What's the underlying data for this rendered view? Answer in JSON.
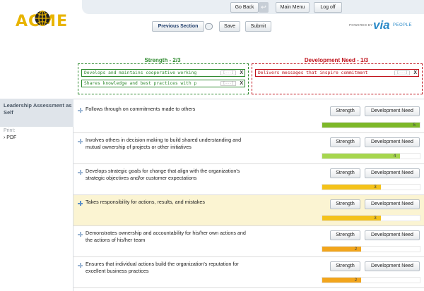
{
  "header": {
    "logo_text": "ACME",
    "nav": {
      "go_back": "Go Back",
      "main_menu": "Main Menu",
      "log_off": "Log off"
    },
    "powered_by": "POWERED BY",
    "brand_via": "via",
    "brand_people": "PEOPLE"
  },
  "actions": {
    "previous_section": "Previous Section",
    "save": "Save",
    "submit": "Submit"
  },
  "summary": {
    "strength": {
      "title": "Strength - 2/3",
      "color": "#2f8a2f",
      "items": [
        "Develops and maintains cooperative working",
        "Shares knowledge and best practices with p"
      ]
    },
    "development": {
      "title": "Development Need - 1/3",
      "color": "#c0121b",
      "items": [
        "Delivers messages that inspire commitment"
      ]
    },
    "chip_ellipsis": "[...]",
    "chip_remove": "X"
  },
  "sidebar": {
    "heading": "Leadership Assessment as Self",
    "print_label": "Print:",
    "pdf_link": "PDF"
  },
  "rows": [
    {
      "text": "Follows through on commitments made to others",
      "strength": "Strength",
      "development": "Development Need",
      "score": 5,
      "max": 5,
      "color": "#7db828"
    },
    {
      "text": "Involves others in decision making to build shared understanding and mutual ownership of projects or other initiatives",
      "strength": "Strength",
      "development": "Development Need",
      "score": 4,
      "max": 5,
      "color": "#a6d64e"
    },
    {
      "text": "Develops strategic goals for change that align with the organization's strategic objectives and/or customer expectations",
      "strength": "Strength",
      "development": "Development Need",
      "score": 3,
      "max": 5,
      "color": "#f4c21a"
    },
    {
      "text": "Takes responsibility for actions, results, and mistakes",
      "strength": "Strength",
      "development": "Development Need",
      "score": 3,
      "max": 5,
      "color": "#f4c21a"
    },
    {
      "text": "Demonstrates ownership and accountability for his/her own actions and the actions of his/her team",
      "strength": "Strength",
      "development": "Development Need",
      "score": 2,
      "max": 5,
      "color": "#f2a51c"
    },
    {
      "text": "Ensures that individual actions build the organization's reputation for excellent business practices",
      "strength": "Strength",
      "development": "Development Need",
      "score": 2,
      "max": 5,
      "color": "#f2a51c"
    }
  ]
}
